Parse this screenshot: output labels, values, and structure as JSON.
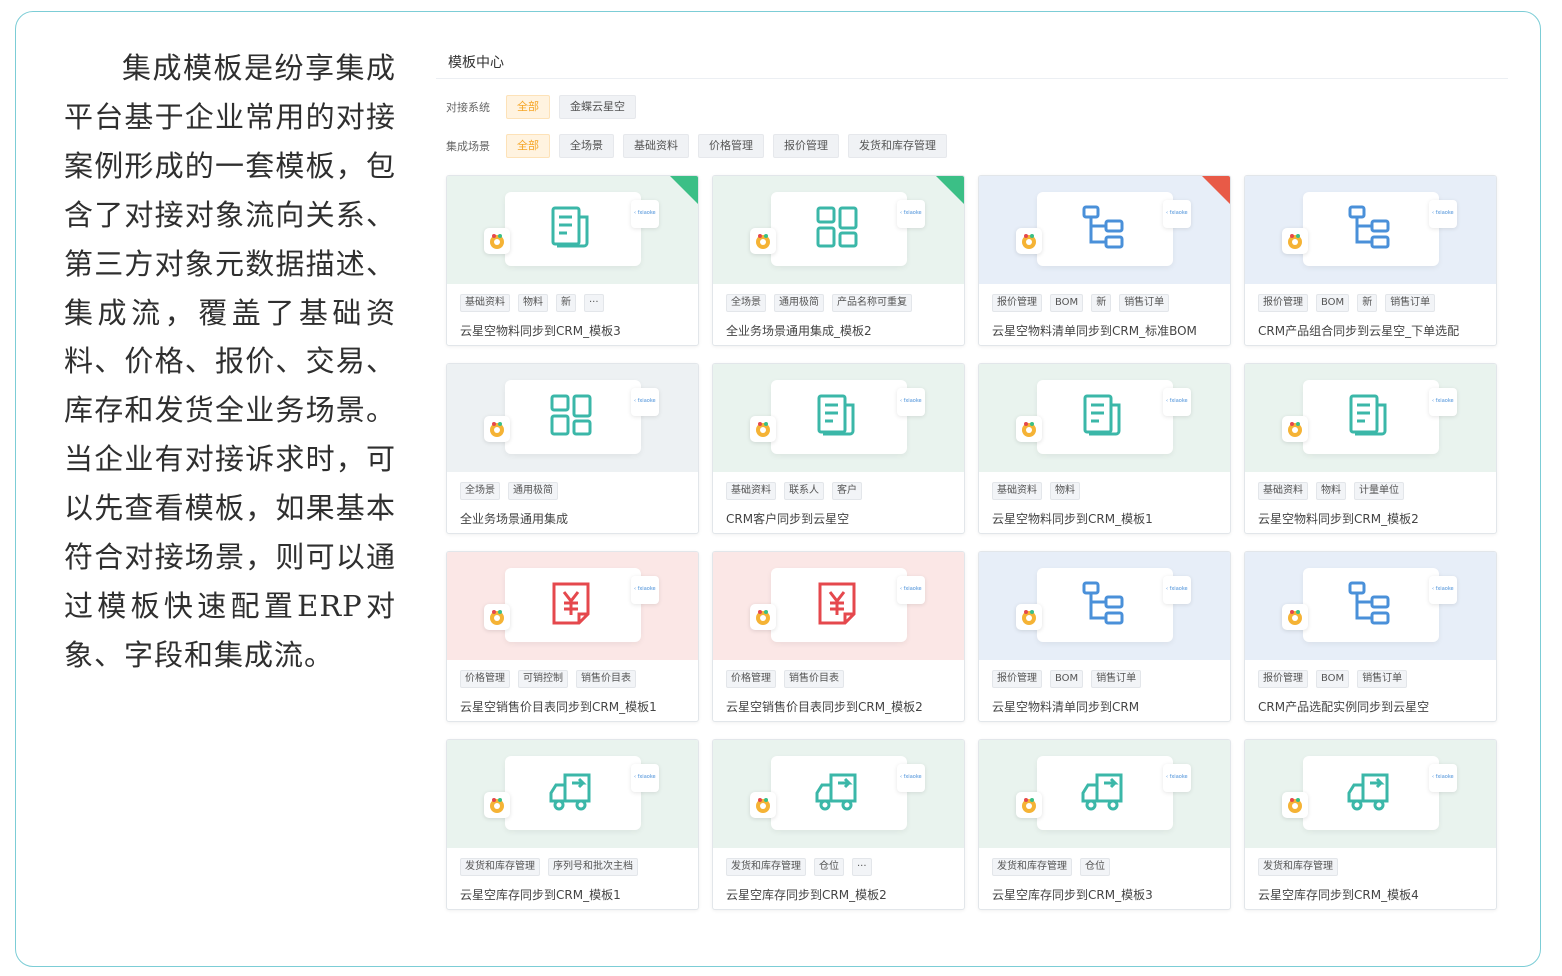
{
  "paragraph": "集成模板是纷享集成平台基于企业常用的对接案例形成的一套模板，包含了对接对象流向关系、第三方对象元数据描述、集成流，覆盖了基础资料、价格、报价、交易、库存和发货全业务场景。当企业有对接诉求时，可以先查看模板，如果基本符合对接场景，则可以通过模板快速配置ERP对象、字段和集成流。",
  "panel": {
    "title": "模板中心",
    "system_filter": {
      "label": "对接系统",
      "options": [
        "全部",
        "金蝶云星空"
      ],
      "active": 0
    },
    "scene_filter": {
      "label": "集成场景",
      "options": [
        "全部",
        "全场景",
        "基础资料",
        "价格管理",
        "报价管理",
        "发货和库存管理"
      ],
      "active": 0
    }
  },
  "colors": {
    "accent_orange": "#f5a524",
    "teal_icon": "#3bb7a8",
    "blue_icon": "#4a90d9",
    "red_icon": "#e5484d",
    "ribbon_green": "#3bbf86",
    "ribbon_red": "#e85a47"
  },
  "cards": [
    {
      "title": "云星空物料同步到CRM_模板3",
      "tags": [
        "基础资料",
        "物料",
        "新",
        "···"
      ],
      "icon": "document-icon",
      "bg": "green",
      "ribbon": "green"
    },
    {
      "title": "全业务场景通用集成_模板2",
      "tags": [
        "全场景",
        "通用极简",
        "产品名称可重复"
      ],
      "icon": "blocks-icon",
      "bg": "green",
      "ribbon": "green"
    },
    {
      "title": "云星空物料清单同步到CRM_标准BOM",
      "tags": [
        "报价管理",
        "BOM",
        "新",
        "销售订单"
      ],
      "icon": "tree-icon",
      "bg": "blue",
      "ribbon": "red"
    },
    {
      "title": "CRM产品组合同步到云星空_下单选配",
      "tags": [
        "报价管理",
        "BOM",
        "新",
        "销售订单"
      ],
      "icon": "tree-icon",
      "bg": "blue",
      "ribbon": ""
    },
    {
      "title": "全业务场景通用集成",
      "tags": [
        "全场景",
        "通用极简"
      ],
      "icon": "blocks-icon",
      "bg": "grey",
      "ribbon": ""
    },
    {
      "title": "CRM客户同步到云星空",
      "tags": [
        "基础资料",
        "联系人",
        "客户"
      ],
      "icon": "document-icon",
      "bg": "green",
      "ribbon": ""
    },
    {
      "title": "云星空物料同步到CRM_模板1",
      "tags": [
        "基础资料",
        "物料"
      ],
      "icon": "document-icon",
      "bg": "green",
      "ribbon": ""
    },
    {
      "title": "云星空物料同步到CRM_模板2",
      "tags": [
        "基础资料",
        "物料",
        "计量单位"
      ],
      "icon": "document-icon",
      "bg": "green",
      "ribbon": ""
    },
    {
      "title": "云星空销售价目表同步到CRM_模板1",
      "tags": [
        "价格管理",
        "可销控制",
        "销售价目表"
      ],
      "icon": "price-icon",
      "bg": "pink",
      "ribbon": ""
    },
    {
      "title": "云星空销售价目表同步到CRM_模板2",
      "tags": [
        "价格管理",
        "销售价目表"
      ],
      "icon": "price-icon",
      "bg": "pink",
      "ribbon": ""
    },
    {
      "title": "云星空物料清单同步到CRM",
      "tags": [
        "报价管理",
        "BOM",
        "销售订单"
      ],
      "icon": "tree-icon",
      "bg": "blue",
      "ribbon": ""
    },
    {
      "title": "CRM产品选配实例同步到云星空",
      "tags": [
        "报价管理",
        "BOM",
        "销售订单"
      ],
      "icon": "tree-icon",
      "bg": "blue",
      "ribbon": ""
    },
    {
      "title": "云星空库存同步到CRM_模板1",
      "tags": [
        "发货和库存管理",
        "序列号和批次主档"
      ],
      "icon": "truck-icon",
      "bg": "green",
      "ribbon": ""
    },
    {
      "title": "云星空库存同步到CRM_模板2",
      "tags": [
        "发货和库存管理",
        "仓位",
        "···"
      ],
      "icon": "truck-icon",
      "bg": "green",
      "ribbon": ""
    },
    {
      "title": "云星空库存同步到CRM_模板3",
      "tags": [
        "发货和库存管理",
        "仓位"
      ],
      "icon": "truck-icon",
      "bg": "green",
      "ribbon": ""
    },
    {
      "title": "云星空库存同步到CRM_模板4",
      "tags": [
        "发货和库存管理"
      ],
      "icon": "truck-icon",
      "bg": "green",
      "ribbon": ""
    }
  ]
}
